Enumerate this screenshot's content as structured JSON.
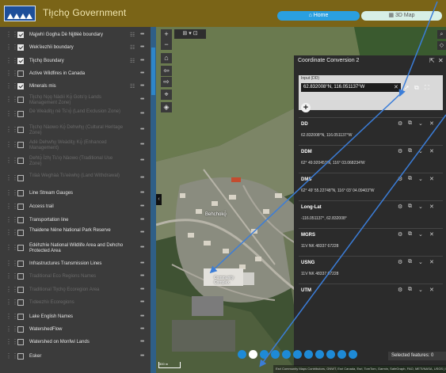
{
  "header": {
    "title": "Tłı̨chǫ Government",
    "tabs": [
      {
        "label": "⌂  Home",
        "active": true
      },
      {
        "label": "▦  3D Map",
        "active": false
      }
    ]
  },
  "layers": [
    {
      "name": "Mąįwhì Gogha Dè Nįįtłèè boundary",
      "checked": true,
      "dim": false
    },
    {
      "name": "Wek'èezhìi boundary",
      "checked": true,
      "dim": false
    },
    {
      "name": "Tłı̨chǫ Boundary",
      "checked": true,
      "dim": false
    },
    {
      "name": "Active Wildfires in Canada",
      "checked": false,
      "dim": false
    },
    {
      "name": "Minerals mis",
      "checked": true,
      "dim": false
    },
    {
      "name": "Tłı̨chǫ Nǫǫ Nàdıì Kǫ̀ Gots'ǫ Lands Management Zone)",
      "checked": false,
      "dim": true
    },
    {
      "name": "Dè Weàditı̨ı̨ nè Ts'ıǫ̀ (Land Exclusion Zone)",
      "checked": false,
      "dim": true
    },
    {
      "name": "Tłı̨chǫ Nàowo Kǫ̀ Dehwhı̨ı̨ (Cultural Heritage Zone)",
      "checked": false,
      "dim": true
    },
    {
      "name": "Adè Dehwhı̨ı̨ Weàditı̨ı̨ Kǫ̀ (Enhanced Management)",
      "checked": false,
      "dim": true
    },
    {
      "name": "Dehtǫ̀ Ìzhı̨ Ts'ıǫ Nàowo (Traditional Use Zone)",
      "checked": false,
      "dim": true
    },
    {
      "name": "Tılàà Weghàà Ts'eèwhǫ (Land Withdrawal)",
      "checked": false,
      "dim": true
    },
    {
      "name": "Line Stream Gauges",
      "checked": false,
      "dim": false
    },
    {
      "name": "Access trail",
      "checked": false,
      "dim": false
    },
    {
      "name": "Transportation line",
      "checked": false,
      "dim": false
    },
    {
      "name": "Thaidene Nëne National Park Reserve",
      "checked": false,
      "dim": false
    },
    {
      "name": "Edéhzhíe National Wildlife Area and Dehcho Protected Area",
      "checked": false,
      "dim": false
    },
    {
      "name": "Infrastructures Transmission Lines",
      "checked": false,
      "dim": false
    },
    {
      "name": "Traditional Eco Regions Names",
      "checked": false,
      "dim": true
    },
    {
      "name": "Traditional Tłı̨chǫ Ecoregion Area",
      "checked": false,
      "dim": true
    },
    {
      "name": "Tıdeezhìı Ecoregions",
      "checked": false,
      "dim": true
    },
    {
      "name": "Lake English Names",
      "checked": false,
      "dim": false
    },
    {
      "name": "WatershedFlow",
      "checked": false,
      "dim": false
    },
    {
      "name": "Watershed on Monfwi Lands",
      "checked": false,
      "dim": false
    },
    {
      "name": "Esker",
      "checked": false,
      "dim": false
    }
  ],
  "map": {
    "town_label": "Behchokǫ̀",
    "poi_label": "Community Complex",
    "scale": "300 m",
    "attribution": "Esri Community Maps Contributors, GNWT, Esri Canada, Esri, TomTom, Garmin, SafeGraph, FAO, METI/NASA, USGS | Powered by Esri",
    "selected_features": "Selected features: 0"
  },
  "coord_widget": {
    "title": "Coordinate Conversion 2",
    "input_label": "Input (DD)",
    "input_value": "62.832008°N, 116.051137°W",
    "formats": [
      {
        "name": "DD",
        "value": "62.832008°N, 116.051137°W"
      },
      {
        "name": "DDM",
        "value": "62° 49.920457'N, 116° 03.068234'W"
      },
      {
        "name": "DMS",
        "value": "62° 49' 55.22748\"N, 116° 03' 04.09403\"W"
      },
      {
        "name": "Long-Lat",
        "value": "-116.051137°, 62.832008°"
      },
      {
        "name": "MGRS",
        "value": "11V NK 48337 67228"
      },
      {
        "name": "USNG",
        "value": "11V NK 48337 67228"
      },
      {
        "name": "UTM",
        "value": ""
      }
    ]
  },
  "colors": {
    "header_bg": "#7a6417",
    "accent": "#2a9fe0",
    "panel_bg": "#3b3b3b",
    "annotation_arrow": "#3b7dd8"
  }
}
